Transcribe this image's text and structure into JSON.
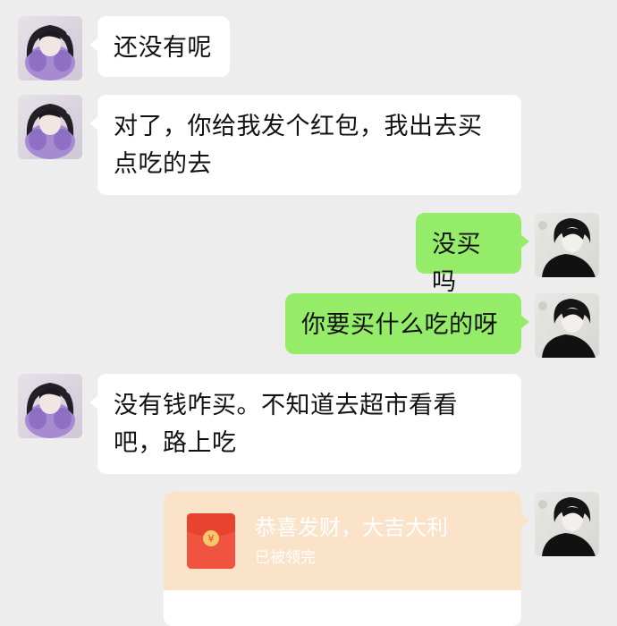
{
  "messages": [
    {
      "side": "in",
      "text": "还没有呢"
    },
    {
      "side": "in",
      "text": "对了，你给我发个红包，我出去买点吃的去"
    },
    {
      "side": "out",
      "text": "没买吗"
    },
    {
      "side": "out",
      "text": "你要买什么吃的呀"
    },
    {
      "side": "in",
      "text": "没有钱咋买。不知道去超市看看吧，路上吃"
    }
  ],
  "red_packet": {
    "title": "恭喜发财，大吉大利",
    "status": "已被领完",
    "color": "#fbe3c9"
  },
  "colors": {
    "background": "#ededed",
    "incoming_bubble": "#ffffff",
    "outgoing_bubble": "#95ec69"
  }
}
